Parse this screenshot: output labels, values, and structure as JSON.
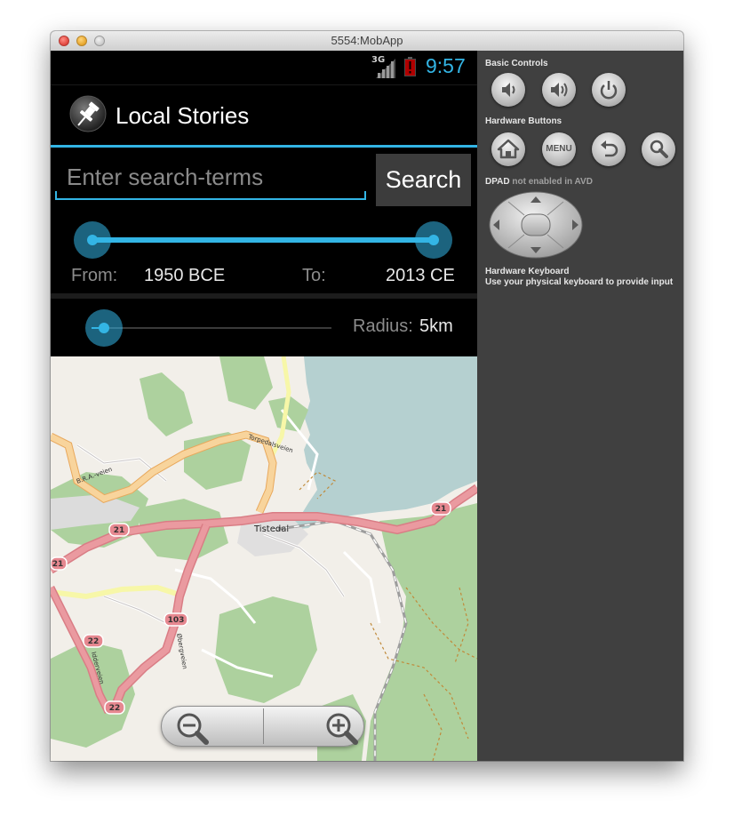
{
  "window": {
    "title": "5554:MobApp"
  },
  "status_bar": {
    "network": "3G",
    "time": "9:57",
    "accent": "#33b5e5"
  },
  "action_bar": {
    "title": "Local Stories",
    "icon": "pushpin-icon"
  },
  "search": {
    "placeholder": "Enter search-terms",
    "value": "",
    "button_label": "Search"
  },
  "time_range": {
    "from_label": "From:",
    "from_value": "1950 BCE",
    "to_label": "To:",
    "to_value": "2013 CE"
  },
  "radius": {
    "label": "Radius:",
    "value": "5km"
  },
  "map": {
    "place_labels": [
      "Tistedal"
    ],
    "road_labels": [
      "Torpedalsveien",
      "B.R.A.-veien",
      "Idderveien",
      "Øbergveien"
    ],
    "route_shields": [
      "21",
      "21",
      "21",
      "103",
      "22",
      "22"
    ],
    "zoom_controls": [
      "zoom-out-icon",
      "zoom-in-icon"
    ]
  },
  "emulator_panel": {
    "basic_controls_label": "Basic Controls",
    "basic_controls": [
      "volume-down-icon",
      "volume-up-icon",
      "power-icon"
    ],
    "hardware_buttons_label": "Hardware Buttons",
    "hardware_buttons": [
      "home-icon",
      "menu",
      "back-icon",
      "search-icon"
    ],
    "menu_label": "MENU",
    "dpad_label": "DPAD",
    "dpad_note": "not enabled in AVD",
    "keyboard_label": "Hardware Keyboard",
    "keyboard_note": "Use your physical keyboard to provide input"
  }
}
